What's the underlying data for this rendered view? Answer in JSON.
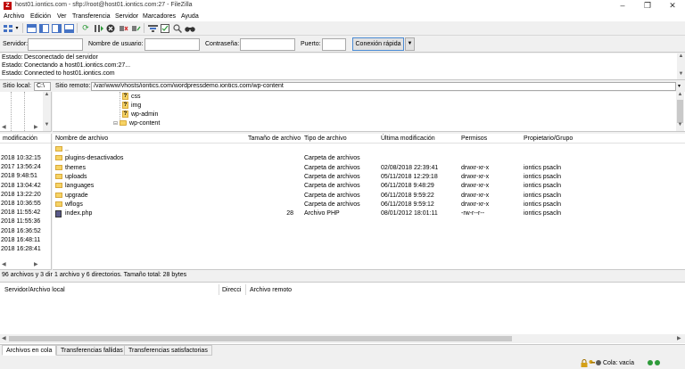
{
  "window": {
    "title": "host01.iontics.com - sftp://root@host01.iontics.com:27 - FileZilla",
    "app_icon_letter": "Z"
  },
  "menu": [
    "Archivo",
    "Edición",
    "Ver",
    "Transferencia",
    "Servidor",
    "Marcadores",
    "Ayuda"
  ],
  "quickconnect": {
    "server_label": "Servidor:",
    "user_label": "Nombre de usuario:",
    "password_label": "Contraseña:",
    "port_label": "Puerto:",
    "connect_button": "Conexión rápida",
    "server_value": "",
    "user_value": "",
    "password_value": "",
    "port_value": ""
  },
  "log": [
    {
      "key": "Estado:",
      "text": "Desconectado del servidor"
    },
    {
      "key": "Estado:",
      "text": "Conectando a host01.iontics.com:27..."
    },
    {
      "key": "Estado:",
      "text": "Connected to host01.iontics.com"
    }
  ],
  "local_site": {
    "label": "Sitio local:",
    "value": "C:\\",
    "column_modified": "modificación",
    "dates": [
      "2018 10:32:15",
      "2017 13:56:24",
      "2018 9:48:51",
      "2018 13:04:42",
      "2018 13:22:20",
      "2018 10:36:55",
      "2018 11:55:42",
      "2018 11:55:36",
      "2018 16:36:52",
      "2018 16:48:11",
      "2018 16:28:41"
    ],
    "status": "96 archivos y 3 dir"
  },
  "remote_site": {
    "label": "Sitio remoto:",
    "path": "/var/www/vhosts/iontics.com/wordpressdemo.iontics.com/wp-content",
    "tree": [
      {
        "name": "css",
        "unknown": true
      },
      {
        "name": "img",
        "unknown": true
      },
      {
        "name": "wp-admin",
        "unknown": true
      },
      {
        "name": "wp-content",
        "unknown": false
      }
    ],
    "tree_expander": "⊟",
    "columns": [
      "Nombre de archivo",
      "Tamaño de archivo",
      "Tipo de archivo",
      "Última modificación",
      "Permisos",
      "Propietario/Grupo"
    ],
    "files": [
      {
        "name": "..",
        "size": "",
        "type": "",
        "modified": "",
        "perms": "",
        "owner": "",
        "kind": "folder"
      },
      {
        "name": "plugins-desactivados",
        "size": "",
        "type": "Carpeta de archivos",
        "modified": "",
        "perms": "",
        "owner": "",
        "kind": "folder"
      },
      {
        "name": "themes",
        "size": "",
        "type": "Carpeta de archivos",
        "modified": "02/08/2018 22:39:41",
        "perms": "drwxr-xr-x",
        "owner": "iontics psacln",
        "kind": "folder"
      },
      {
        "name": "uploads",
        "size": "",
        "type": "Carpeta de archivos",
        "modified": "05/11/2018 12:29:18",
        "perms": "drwxr-xr-x",
        "owner": "iontics psacln",
        "kind": "folder"
      },
      {
        "name": "languages",
        "size": "",
        "type": "Carpeta de archivos",
        "modified": "06/11/2018 9:48:29",
        "perms": "drwxr-xr-x",
        "owner": "iontics psacln",
        "kind": "folder"
      },
      {
        "name": "upgrade",
        "size": "",
        "type": "Carpeta de archivos",
        "modified": "06/11/2018 9:59:22",
        "perms": "drwxr-xr-x",
        "owner": "iontics psacln",
        "kind": "folder"
      },
      {
        "name": "wflogs",
        "size": "",
        "type": "Carpeta de archivos",
        "modified": "06/11/2018 9:59:12",
        "perms": "drwxr-xr-x",
        "owner": "iontics psacln",
        "kind": "folder"
      },
      {
        "name": "index.php",
        "size": "28",
        "type": "Archivo PHP",
        "modified": "08/01/2012 18:01:11",
        "perms": "-rw-r--r--",
        "owner": "iontics psacln",
        "kind": "file"
      }
    ],
    "status": "1 archivo y 6 directorios. Tamaño total: 28 bytes"
  },
  "queue": {
    "columns": [
      "Servidor/Archivo local",
      "Direcci",
      "Archivo remoto"
    ]
  },
  "tabs": [
    "Archivos en cola",
    "Transferencias fallidas",
    "Transferencias satisfactorias"
  ],
  "statusbar": {
    "queue_text": "Cola: vacía"
  },
  "colors": {
    "folder": "#f6d365",
    "folder_border": "#d8a93b",
    "app_icon": "#bf0000",
    "focus": "#4a8ad3"
  }
}
